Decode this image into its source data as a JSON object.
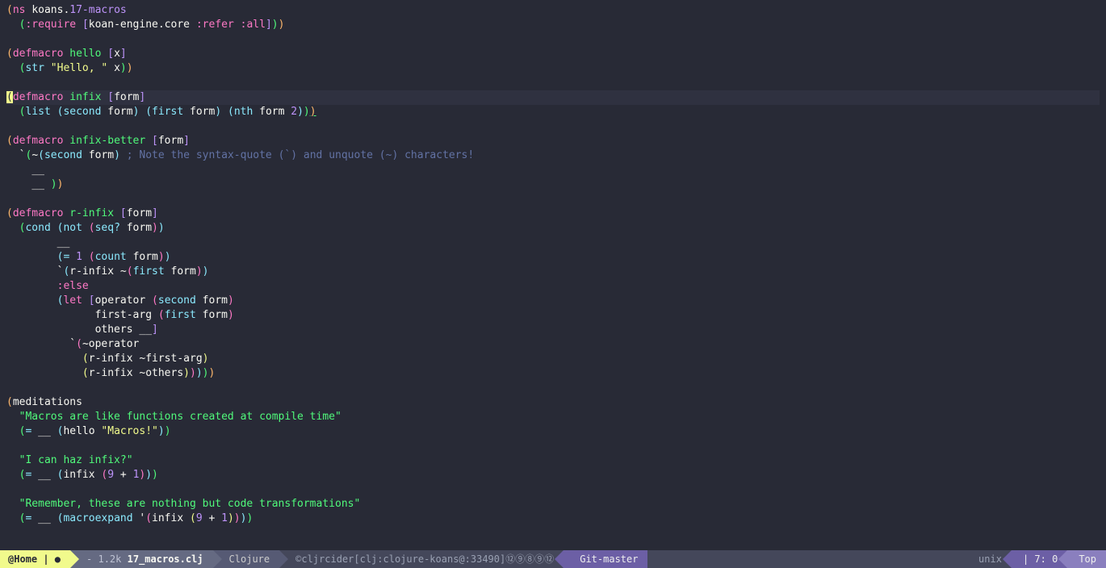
{
  "lines": [
    {
      "hl": false,
      "html": "<span class='parR'>(</span><span class='kw'>ns</span> <span class='sym'>koans</span><span class='sym'>.</span><span class='nspart'>17-macros</span>"
    },
    {
      "hl": false,
      "html": "  <span class='parG'>(</span><span class='key'>:require</span> <span class='br'>[</span><span class='sym'>koan-engine.core</span> <span class='key'>:refer</span> <span class='key'>:all</span><span class='br'>]</span><span class='parG'>)</span><span class='parR'>)</span>"
    },
    {
      "hl": false,
      "html": ""
    },
    {
      "hl": false,
      "html": "<span class='parR'>(</span><span class='kw'>defmacro</span> <span class='name'>hello</span> <span class='br'>[</span><span class='sym'>x</span><span class='br'>]</span>"
    },
    {
      "hl": false,
      "html": "  <span class='parG'>(</span><span class='bi'>str</span> <span class='str'>\"Hello, \"</span> <span class='sym'>x</span><span class='parG'>)</span><span class='parR'>)</span>"
    },
    {
      "hl": false,
      "html": ""
    },
    {
      "hl": true,
      "html": "<span class='cursor'>(</span><span class='kw'>defmacro</span> <span class='name'>infix</span> <span class='br'>[</span><span class='sym'>form</span><span class='br'>]</span>"
    },
    {
      "hl": false,
      "html": "  <span class='parG'>(</span><span class='bi'>list</span> <span class='parB'>(</span><span class='bi'>second</span> <span class='sym'>form</span><span class='parB'>)</span> <span class='parB'>(</span><span class='bi'>first</span> <span class='sym'>form</span><span class='parB'>)</span> <span class='parB'>(</span><span class='bi'>nth</span> <span class='sym'>form</span> <span class='num'>2</span><span class='parB'>)</span><span class='parG'>)</span><span class='parR underline'>)</span>"
    },
    {
      "hl": false,
      "html": ""
    },
    {
      "hl": false,
      "html": "<span class='parR'>(</span><span class='kw'>defmacro</span> <span class='name'>infix-better</span> <span class='br'>[</span><span class='sym'>form</span><span class='br'>]</span>"
    },
    {
      "hl": false,
      "html": "  <span class='sym'>`</span><span class='parG'>(</span><span class='sym'>~</span><span class='parB'>(</span><span class='bi'>second</span> <span class='sym'>form</span><span class='parB'>)</span> <span class='cmt'>; Note the syntax-quote (`) and unquote (~) characters!</span>"
    },
    {
      "hl": false,
      "html": "    <span class='sym'>__</span>"
    },
    {
      "hl": false,
      "html": "    <span class='sym'>__</span> <span class='parG'>)</span><span class='parR'>)</span>"
    },
    {
      "hl": false,
      "html": ""
    },
    {
      "hl": false,
      "html": "<span class='parR'>(</span><span class='kw'>defmacro</span> <span class='name'>r-infix</span> <span class='br'>[</span><span class='sym'>form</span><span class='br'>]</span>"
    },
    {
      "hl": false,
      "html": "  <span class='parG'>(</span><span class='bi'>cond</span> <span class='parB'>(</span><span class='bi'>not</span> <span class='parP'>(</span><span class='bi'>seq?</span> <span class='sym'>form</span><span class='parP'>)</span><span class='parB'>)</span>"
    },
    {
      "hl": false,
      "html": "        <span class='sym'>__</span>"
    },
    {
      "hl": false,
      "html": "        <span class='parB'>(</span><span class='bi'>=</span> <span class='num'>1</span> <span class='parP'>(</span><span class='bi'>count</span> <span class='sym'>form</span><span class='parP'>)</span><span class='parB'>)</span>"
    },
    {
      "hl": false,
      "html": "        <span class='sym'>`</span><span class='parB'>(</span><span class='sym'>r-infix</span> <span class='sym'>~</span><span class='parP'>(</span><span class='bi'>first</span> <span class='sym'>form</span><span class='parP'>)</span><span class='parB'>)</span>"
    },
    {
      "hl": false,
      "html": "        <span class='key'>:else</span>"
    },
    {
      "hl": false,
      "html": "        <span class='parB'>(</span><span class='kw'>let</span> <span class='br'>[</span><span class='sym'>operator</span> <span class='parP'>(</span><span class='bi'>second</span> <span class='sym'>form</span><span class='parP'>)</span>"
    },
    {
      "hl": false,
      "html": "              <span class='sym'>first-arg</span> <span class='parP'>(</span><span class='bi'>first</span> <span class='sym'>form</span><span class='parP'>)</span>"
    },
    {
      "hl": false,
      "html": "              <span class='sym'>others</span> <span class='sym'>__</span><span class='br'>]</span>"
    },
    {
      "hl": false,
      "html": "          <span class='sym'>`</span><span class='parP'>(</span><span class='sym'>~operator</span>"
    },
    {
      "hl": false,
      "html": "            <span class='parY'>(</span><span class='sym'>r-infix</span> <span class='sym'>~first-arg</span><span class='parY'>)</span>"
    },
    {
      "hl": false,
      "html": "            <span class='parY'>(</span><span class='sym'>r-infix</span> <span class='sym'>~others</span><span class='parY'>)</span><span class='parP'>)</span><span class='parB'>)</span><span class='parG'>)</span><span class='parR'>)</span>"
    },
    {
      "hl": false,
      "html": ""
    },
    {
      "hl": false,
      "html": "<span class='parR'>(</span><span class='sym'>meditations</span>"
    },
    {
      "hl": false,
      "html": "  <span class='doc'>\"Macros are like functions created at compile time\"</span>"
    },
    {
      "hl": false,
      "html": "  <span class='parG'>(</span><span class='bi'>=</span> <span class='sym'>__</span> <span class='parB'>(</span><span class='sym'>hello</span> <span class='str'>\"Macros!\"</span><span class='parB'>)</span><span class='parG'>)</span>"
    },
    {
      "hl": false,
      "html": ""
    },
    {
      "hl": false,
      "html": "  <span class='doc'>\"I can haz infix?\"</span>"
    },
    {
      "hl": false,
      "html": "  <span class='parG'>(</span><span class='bi'>=</span> <span class='sym'>__</span> <span class='parB'>(</span><span class='sym'>infix</span> <span class='parP'>(</span><span class='num'>9</span> <span class='sym'>+</span> <span class='num'>1</span><span class='parP'>)</span><span class='parB'>)</span><span class='parG'>)</span>"
    },
    {
      "hl": false,
      "html": ""
    },
    {
      "hl": false,
      "html": "  <span class='doc'>\"Remember, these are nothing but code transformations\"</span>"
    },
    {
      "hl": false,
      "html": "  <span class='parG'>(</span><span class='bi'>=</span> <span class='sym'>__</span> <span class='parB'>(</span><span class='bi'>macroexpand</span> <span class='sym'>'</span><span class='parP'>(</span><span class='sym'>infix</span> <span class='parY'>(</span><span class='num'>9</span> <span class='sym'>+</span> <span class='num'>1</span><span class='parY'>)</span><span class='parP'>)</span><span class='parB'>)</span><span class='parG'>)</span>"
    }
  ],
  "modeline": {
    "home": "@Home | ●",
    "size": "- 1.2k",
    "filename": "17_macros.clj",
    "major_mode": "Clojure",
    "cider": "©cljrcider[clj:clojure-koans@:33490]⑫⑨⑧⑨⑫",
    "git": "Git-master",
    "encoding": "unix",
    "position": "7: 0",
    "scroll": "Top"
  }
}
